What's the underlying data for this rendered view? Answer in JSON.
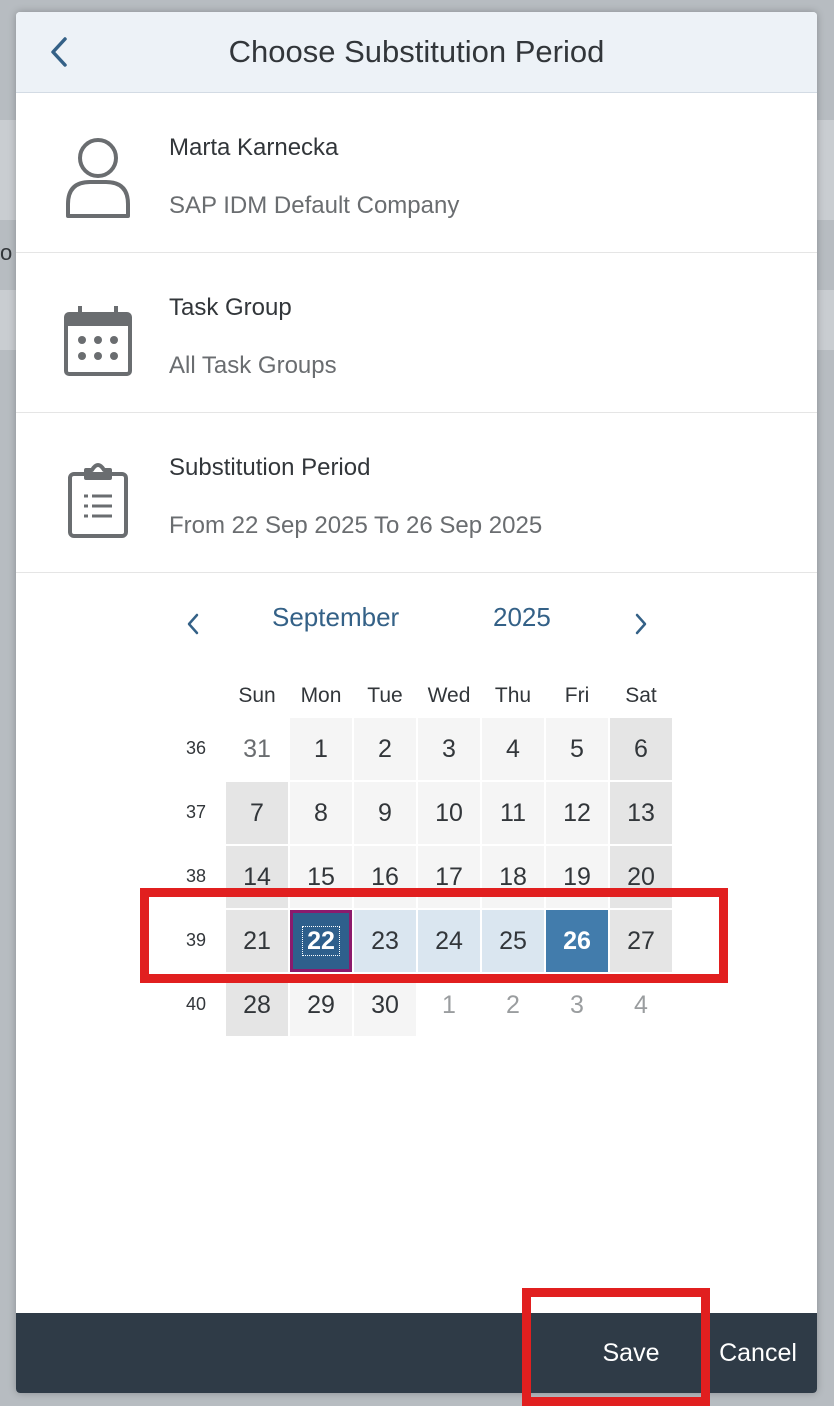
{
  "header": {
    "title": "Choose Substitution Period"
  },
  "person": {
    "name": "Marta Karnecka",
    "company": "SAP IDM Default Company"
  },
  "task_group": {
    "label": "Task Group",
    "value": "All Task Groups"
  },
  "period": {
    "label": "Substitution Period",
    "value": "From 22 Sep 2025 To 26 Sep 2025"
  },
  "calendar": {
    "month": "September",
    "year": "2025",
    "weekdays": [
      "Sun",
      "Mon",
      "Tue",
      "Wed",
      "Thu",
      "Fri",
      "Sat"
    ],
    "weeks": [
      {
        "num": "36",
        "days": [
          "31",
          "1",
          "2",
          "3",
          "4",
          "5",
          "6"
        ]
      },
      {
        "num": "37",
        "days": [
          "7",
          "8",
          "9",
          "10",
          "11",
          "12",
          "13"
        ]
      },
      {
        "num": "38",
        "days": [
          "14",
          "15",
          "16",
          "17",
          "18",
          "19",
          "20"
        ]
      },
      {
        "num": "39",
        "days": [
          "21",
          "22",
          "23",
          "24",
          "25",
          "26",
          "27"
        ]
      },
      {
        "num": "40",
        "days": [
          "28",
          "29",
          "30",
          "1",
          "2",
          "3",
          "4"
        ]
      }
    ],
    "range_start": "22",
    "range_end": "26"
  },
  "footer": {
    "save": "Save",
    "cancel": "Cancel"
  },
  "background": {
    "fragment": "o"
  }
}
